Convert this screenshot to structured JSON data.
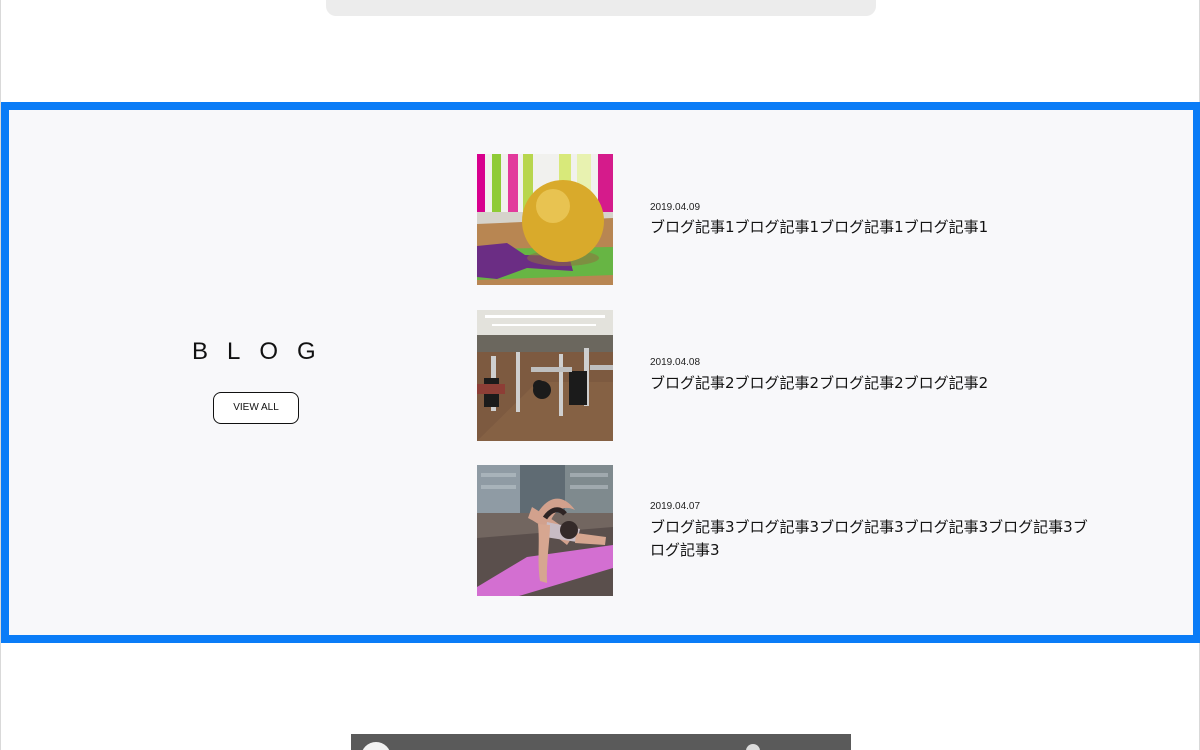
{
  "blog": {
    "heading": "BLOG",
    "view_all_label": "VIEW ALL",
    "posts": [
      {
        "date": "2019.04.09",
        "title": "ブログ記事1ブログ記事1ブログ記事1ブログ記事1",
        "thumbnail": "yellow-exercise-ball-photo"
      },
      {
        "date": "2019.04.08",
        "title": "ブログ記事2ブログ記事2ブログ記事2ブログ記事2",
        "thumbnail": "gym-interior-photo"
      },
      {
        "date": "2019.04.07",
        "title": "ブログ記事3ブログ記事3ブログ記事3ブログ記事3ブログ記事3ブログ記事3",
        "thumbnail": "yoga-stretch-photo"
      }
    ]
  },
  "colors": {
    "section_highlight": "#0a7cf7",
    "section_background": "#f8f8fa",
    "text": "#111111"
  }
}
